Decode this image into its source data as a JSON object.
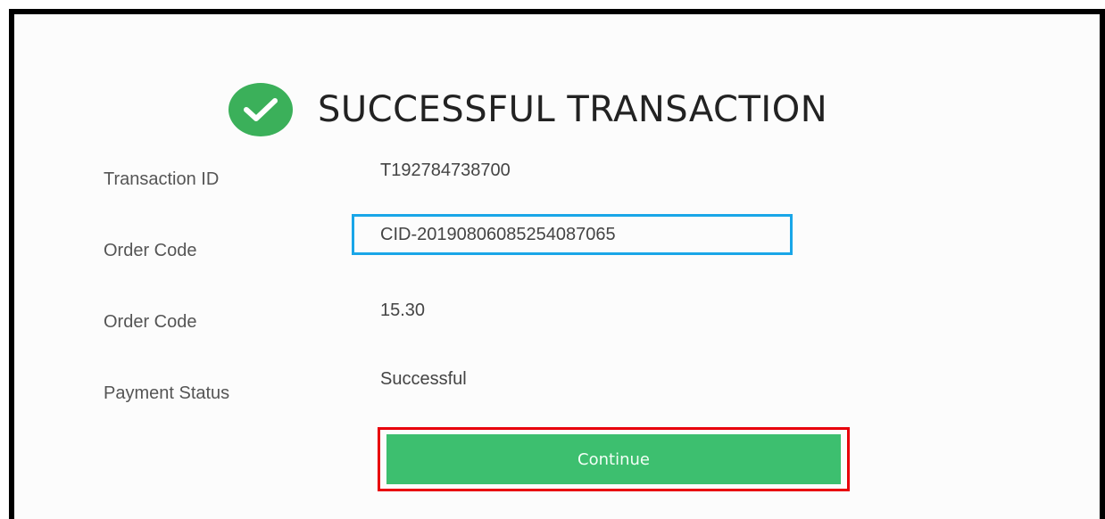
{
  "header": {
    "title": "SUCCESSFUL TRANSACTION",
    "icon": "checkmark-circle-icon",
    "icon_color": "#3bb05a"
  },
  "details": [
    {
      "label": "Transaction ID",
      "value": "T192784738700"
    },
    {
      "label": "Order Code",
      "value": "CID-20190806085254087065"
    },
    {
      "label": "Order Code",
      "value": "15.30"
    },
    {
      "label": "Payment Status",
      "value": "Successful"
    }
  ],
  "actions": {
    "continue_label": "Continue",
    "button_color": "#3dbf6f"
  },
  "annotations": {
    "highlight_color": "#19a6e8",
    "button_outline_color": "#e8000b"
  }
}
